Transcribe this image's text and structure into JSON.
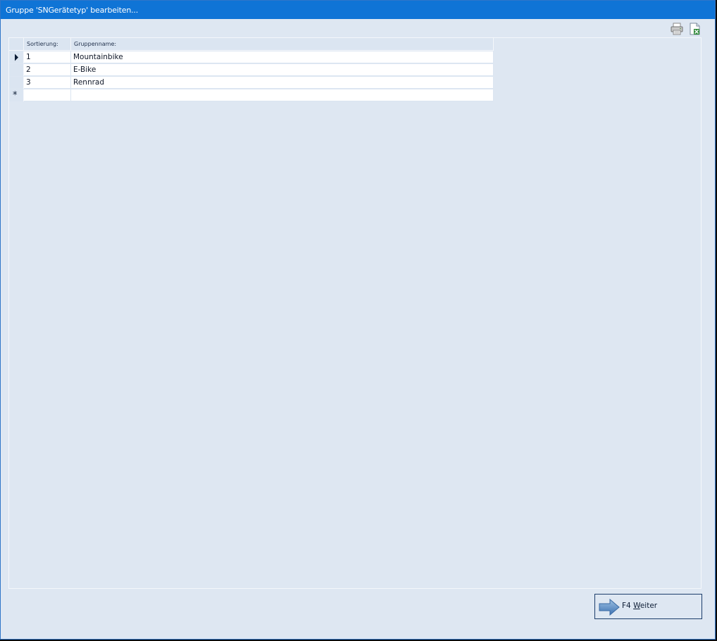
{
  "window": {
    "title": "Gruppe 'SNGerätetyp' bearbeiten..."
  },
  "toolbar": {
    "print_icon": "printer-icon",
    "export_icon": "export-excel-icon"
  },
  "grid": {
    "columns": [
      "Sortierung:",
      "Gruppenname:"
    ],
    "rows": [
      {
        "sort": "1",
        "name": "Mountainbike",
        "current": true
      },
      {
        "sort": "2",
        "name": "E-Bike",
        "current": false
      },
      {
        "sort": "3",
        "name": "Rennrad",
        "current": false
      }
    ],
    "new_row_marker": "*"
  },
  "footer": {
    "weiter_prefix": "F4 ",
    "weiter_mnemonic": "W",
    "weiter_rest": "eiter",
    "weiter_icon": "arrow-right-icon"
  }
}
